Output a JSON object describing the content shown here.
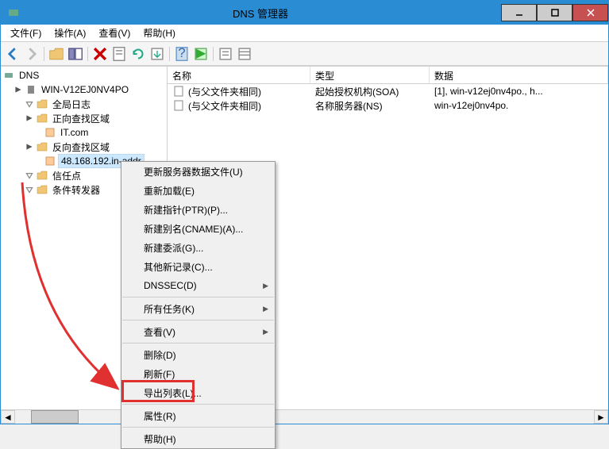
{
  "window": {
    "title": "DNS 管理器"
  },
  "menubar": {
    "file": "文件(F)",
    "action": "操作(A)",
    "view": "查看(V)",
    "help": "帮助(H)"
  },
  "tree": {
    "root": "DNS",
    "server": "WIN-V12EJ0NV4PO",
    "global_log": "全局日志",
    "forward_zone": "正向查找区域",
    "forward_item": "IT.com",
    "reverse_zone": "反向查找区域",
    "reverse_item": "48.168.192.in-addr",
    "trust_points": "信任点",
    "conditional_forwarders": "条件转发器"
  },
  "list": {
    "headers": {
      "name": "名称",
      "type": "类型",
      "data": "数据"
    },
    "rows": [
      {
        "name": "(与父文件夹相同)",
        "type": "起始授权机构(SOA)",
        "data": "[1], win-v12ej0nv4po., h..."
      },
      {
        "name": "(与父文件夹相同)",
        "type": "名称服务器(NS)",
        "data": "win-v12ej0nv4po."
      }
    ]
  },
  "context_menu": {
    "update_data": "更新服务器数据文件(U)",
    "reload": "重新加载(E)",
    "new_ptr": "新建指针(PTR)(P)...",
    "new_cname": "新建别名(CNAME)(A)...",
    "new_delegation": "新建委派(G)...",
    "other_records": "其他新记录(C)...",
    "dnssec": "DNSSEC(D)",
    "all_tasks": "所有任务(K)",
    "view": "查看(V)",
    "delete": "删除(D)",
    "refresh": "刷新(F)",
    "export_list": "导出列表(L)...",
    "properties": "属性(R)",
    "help": "帮助(H)"
  }
}
